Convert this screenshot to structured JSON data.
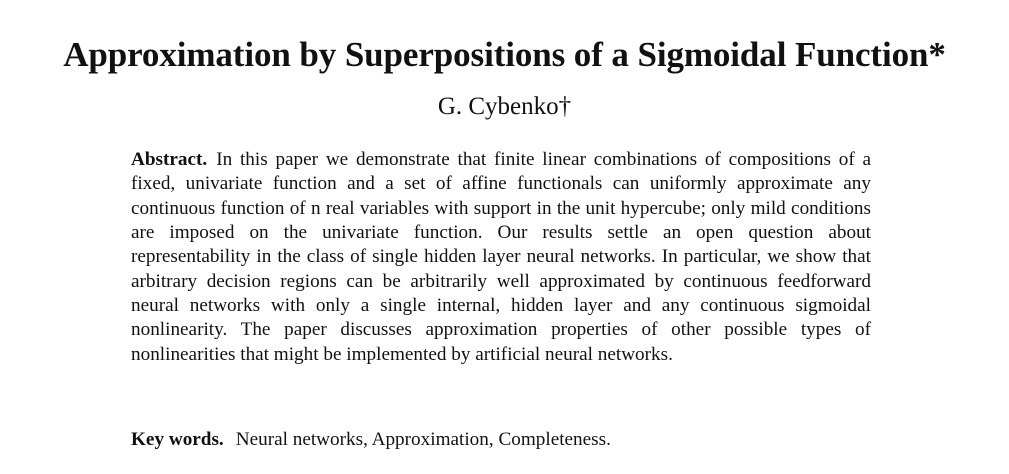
{
  "paper": {
    "title": "Approximation by Superpositions of a Sigmoidal Function*",
    "author": "G. Cybenko†",
    "abstract": {
      "label": "Abstract.",
      "text": "In this paper we demonstrate that finite linear combinations of compositions of a fixed, univariate function and a set of affine functionals can uniformly approximate any continuous function of n real variables with support in the unit hypercube; only mild conditions are imposed on the univariate function. Our results settle an open question about representability in the class of single hidden layer neural networks. In particular, we show that arbitrary decision regions can be arbitrarily well approximated by continuous feedforward neural networks with only a single internal, hidden layer and any continuous sigmoidal nonlinearity. The paper discusses approximation properties of other possible types of nonlinearities that might be implemented by artificial neural networks."
    },
    "keywords": {
      "label": "Key words.",
      "text": "Neural networks, Approximation, Completeness."
    }
  }
}
